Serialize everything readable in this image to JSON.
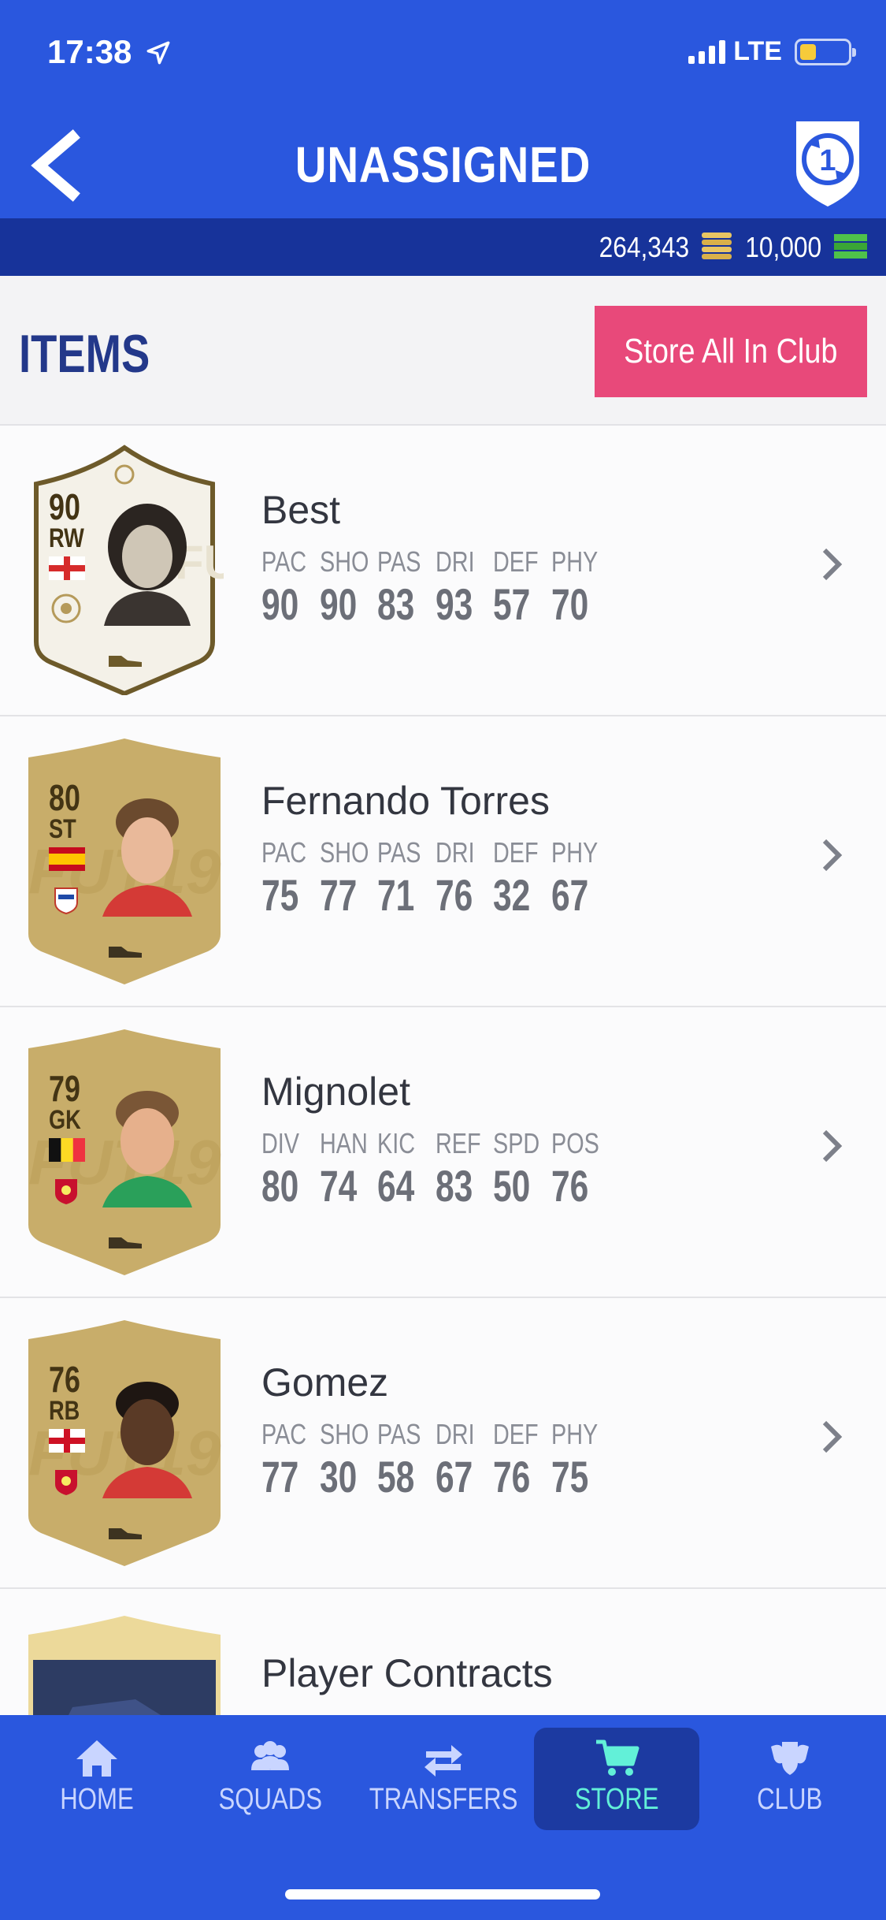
{
  "status_bar": {
    "time": "17:38",
    "network": "LTE"
  },
  "nav": {
    "title": "UNASSIGNED"
  },
  "currency": {
    "coins": "264,343",
    "points": "10,000"
  },
  "items_header": {
    "title": "ITEMS",
    "store_all_label": "Store All In Club"
  },
  "items": [
    {
      "name": "Best",
      "rating": "90",
      "position": "RW",
      "card_type": "icon",
      "stats": [
        {
          "label": "PAC",
          "value": "90"
        },
        {
          "label": "SHO",
          "value": "90"
        },
        {
          "label": "PAS",
          "value": "83"
        },
        {
          "label": "DRI",
          "value": "93"
        },
        {
          "label": "DEF",
          "value": "57"
        },
        {
          "label": "PHY",
          "value": "70"
        }
      ]
    },
    {
      "name": "Fernando Torres",
      "rating": "80",
      "position": "ST",
      "card_type": "gold",
      "stats": [
        {
          "label": "PAC",
          "value": "75"
        },
        {
          "label": "SHO",
          "value": "77"
        },
        {
          "label": "PAS",
          "value": "71"
        },
        {
          "label": "DRI",
          "value": "76"
        },
        {
          "label": "DEF",
          "value": "32"
        },
        {
          "label": "PHY",
          "value": "67"
        }
      ]
    },
    {
      "name": "Mignolet",
      "rating": "79",
      "position": "GK",
      "card_type": "gold",
      "stats": [
        {
          "label": "DIV",
          "value": "80"
        },
        {
          "label": "HAN",
          "value": "74"
        },
        {
          "label": "KIC",
          "value": "64"
        },
        {
          "label": "REF",
          "value": "83"
        },
        {
          "label": "SPD",
          "value": "50"
        },
        {
          "label": "POS",
          "value": "76"
        }
      ]
    },
    {
      "name": "Gomez",
      "rating": "76",
      "position": "RB",
      "card_type": "gold",
      "stats": [
        {
          "label": "PAC",
          "value": "77"
        },
        {
          "label": "SHO",
          "value": "30"
        },
        {
          "label": "PAS",
          "value": "58"
        },
        {
          "label": "DRI",
          "value": "67"
        },
        {
          "label": "DEF",
          "value": "76"
        },
        {
          "label": "PHY",
          "value": "75"
        }
      ]
    }
  ],
  "contract_item": {
    "name": "Player Contracts"
  },
  "tabs": [
    {
      "label": "HOME",
      "icon": "home-icon"
    },
    {
      "label": "SQUADS",
      "icon": "squads-icon"
    },
    {
      "label": "TRANSFERS",
      "icon": "transfers-icon"
    },
    {
      "label": "STORE",
      "icon": "store-icon",
      "active": true
    },
    {
      "label": "CLUB",
      "icon": "club-icon"
    }
  ],
  "colors": {
    "primary_blue": "#2a57de",
    "dark_blue": "#17339a",
    "accent_pink": "#e8497a",
    "active_tab_text": "#62f0d8",
    "gold_card": "#c8ad6a",
    "icon_card": "#f4f1e8"
  }
}
